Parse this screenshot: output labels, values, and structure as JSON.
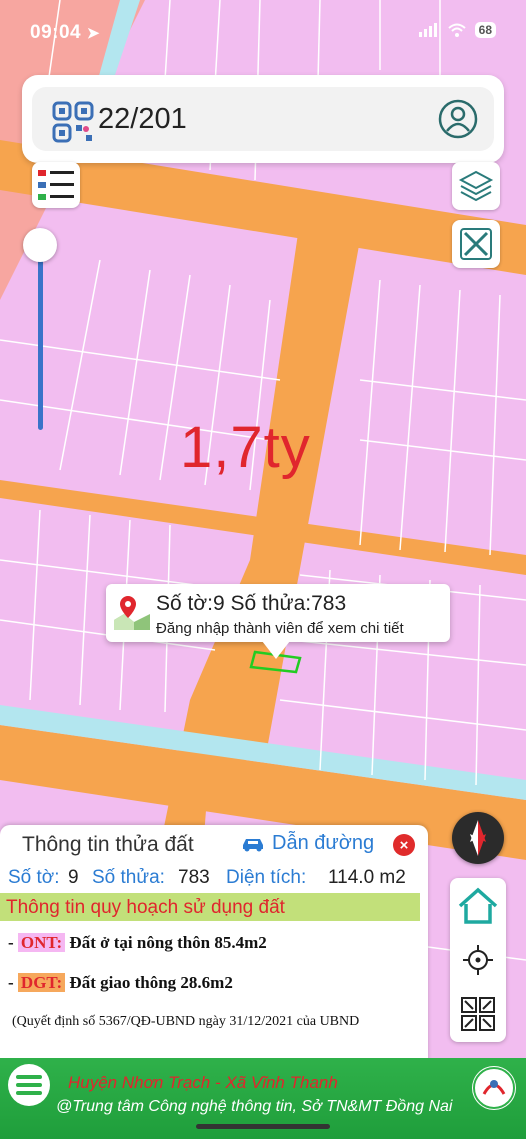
{
  "status_bar": {
    "time": "09:04",
    "battery": "68"
  },
  "search": {
    "value": "22/201"
  },
  "map": {
    "price_label": "1,7ty",
    "colors": {
      "residential": "#f2bdf0",
      "road": "#f6a44e",
      "water": "#b3e6ef",
      "other": "#f7a6a0",
      "parcel_line": "#ffffff",
      "selected_parcel": "#22cc22"
    }
  },
  "popup": {
    "title": "Số tờ:9 Số thửa:783",
    "subtitle": "Đăng nhập thành viên để xem chi tiết"
  },
  "info_panel": {
    "title": "Thông tin thửa đất",
    "directions_label": "Dẫn đường",
    "close_label": "×",
    "sheet_label": "Số tờ:",
    "sheet_value": "9",
    "parcel_label": "Số thửa:",
    "parcel_value": "783",
    "area_label": "Diện tích:",
    "area_value": "114.0 m2",
    "plan_header": "Thông tin quy hoạch sử dụng đất",
    "plan_items": [
      {
        "prefix": "- ",
        "code": "ONT:",
        "text": " Đất ở tại nông thôn 85.4m2"
      },
      {
        "prefix": "- ",
        "code": "DGT:",
        "text": " Đất giao thông 28.6m2"
      }
    ],
    "decision": "(Quyết định số 5367/QĐ-UBND ngày 31/12/2021 của UBND"
  },
  "footer": {
    "line1": "Huyện Nhơn Trạch - Xã Vĩnh Thanh",
    "line2": "@Trung tâm Công nghệ thông tin, Sở TN&MT Đồng Nai"
  },
  "icons": {
    "qr": "qr-code-icon",
    "user": "user-icon",
    "legend": "legend-list-icon",
    "layers": "layers-icon",
    "ruler": "ruler-icon",
    "compass": "compass-icon",
    "home": "home-icon",
    "locate": "crosshair-icon",
    "fullscreen": "expand-icon",
    "menu": "hamburger-menu-icon",
    "car": "car-icon",
    "map_pin": "map-pin-icon"
  }
}
